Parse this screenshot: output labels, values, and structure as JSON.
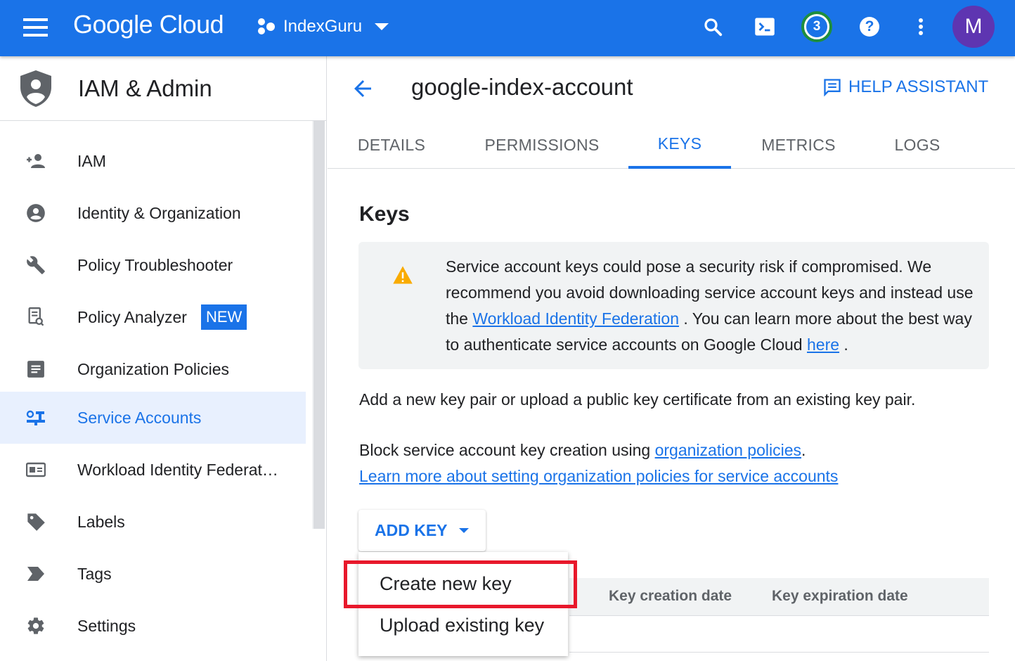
{
  "topbar": {
    "brand": "Google Cloud",
    "project": "IndexGuru",
    "notification_count": "3",
    "avatar_initial": "M"
  },
  "sidebar": {
    "title": "IAM & Admin",
    "items": [
      {
        "label": "IAM",
        "icon": "person-add-icon"
      },
      {
        "label": "Identity & Organization",
        "icon": "account-circle-icon"
      },
      {
        "label": "Policy Troubleshooter",
        "icon": "wrench-icon"
      },
      {
        "label": "Policy Analyzer",
        "icon": "policy-analyzer-icon",
        "badge": "NEW"
      },
      {
        "label": "Organization Policies",
        "icon": "document-icon"
      },
      {
        "label": "Service Accounts",
        "icon": "service-account-icon",
        "active": true
      },
      {
        "label": "Workload Identity Federat…",
        "icon": "id-card-icon"
      },
      {
        "label": "Labels",
        "icon": "label-icon"
      },
      {
        "label": "Tags",
        "icon": "tag-arrow-icon"
      },
      {
        "label": "Settings",
        "icon": "gear-icon"
      }
    ]
  },
  "main": {
    "title": "google-index-account",
    "help_assistant": "HELP ASSISTANT",
    "tabs": [
      "DETAILS",
      "PERMISSIONS",
      "KEYS",
      "METRICS",
      "LOGS"
    ],
    "active_tab": "KEYS",
    "section_title": "Keys",
    "warning": {
      "text_1": "Service account keys could pose a security risk if compromised. We recommend you avoid downloading service account keys and instead use the ",
      "link_1": "Workload Identity Federation",
      "text_2": " . You can learn more about the best way to authenticate service accounts on Google Cloud ",
      "link_2": "here",
      "text_3": " ."
    },
    "add_pair_text": "Add a new key pair or upload a public key certificate from an existing key pair.",
    "block_text": "Block service account key creation using ",
    "block_link": "organization policies",
    "block_period": ".",
    "learn_more_link": "Learn more about setting organization policies for service accounts",
    "add_key_button": "ADD KEY",
    "table_headers": [
      "Key creation date",
      "Key expiration date"
    ],
    "menu": {
      "items": [
        "Create new key",
        "Upload existing key"
      ]
    }
  },
  "colors": {
    "brand_blue": "#1a73e8",
    "highlight_red": "#e8182b",
    "warning_amber": "#f9ab00"
  }
}
